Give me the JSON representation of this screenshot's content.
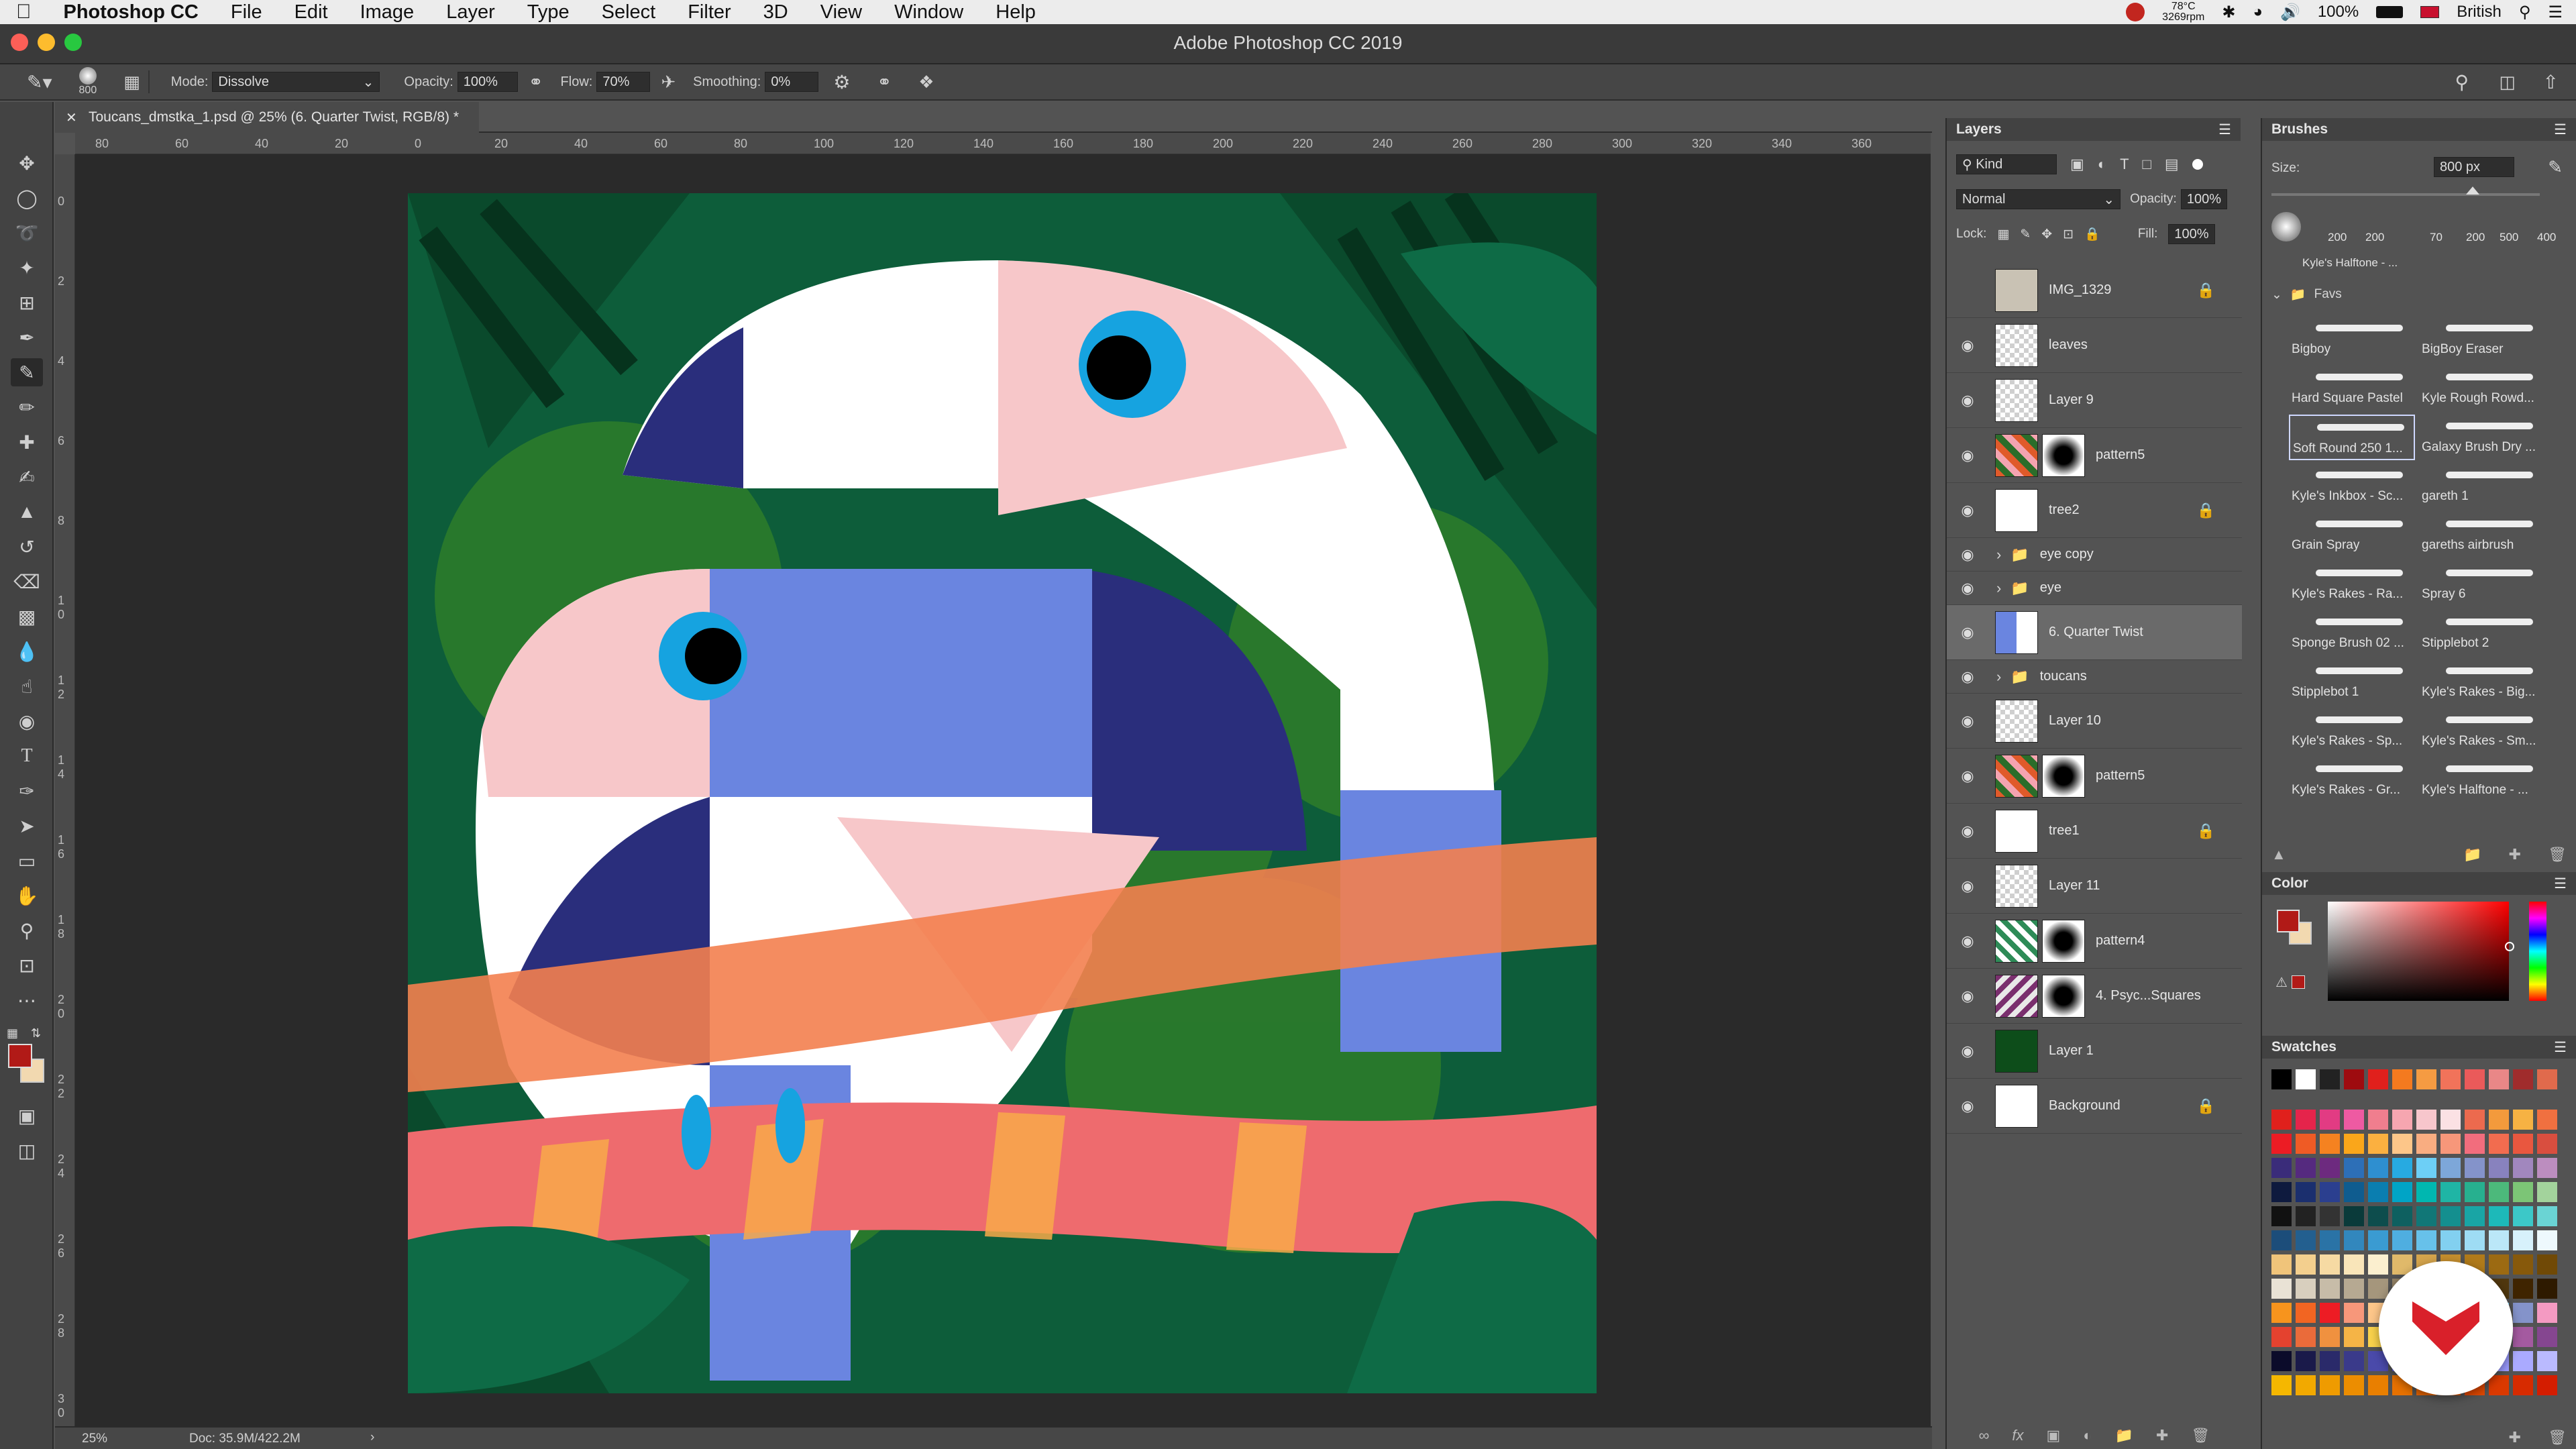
{
  "menubar": {
    "app_name": "Photoshop CC",
    "items": [
      "File",
      "Edit",
      "Image",
      "Layer",
      "Type",
      "Select",
      "Filter",
      "3D",
      "View",
      "Window",
      "Help"
    ],
    "cpu_temp": "78°C",
    "fan_rpm": "3269rpm",
    "battery": "100%",
    "keyboard": "British"
  },
  "window": {
    "title": "Adobe Photoshop CC 2019"
  },
  "options": {
    "brush_size": "800",
    "mode_label": "Mode:",
    "mode_value": "Dissolve",
    "opacity_label": "Opacity:",
    "opacity_value": "100%",
    "flow_label": "Flow:",
    "flow_value": "70%",
    "smoothing_label": "Smoothing:",
    "smoothing_value": "0%"
  },
  "document": {
    "tab_title": "Toucans_dmstka_1.psd @ 25% (6. Quarter Twist, RGB/8) *",
    "ruler_h": [
      "80",
      "60",
      "40",
      "20",
      "0",
      "20",
      "40",
      "60",
      "80",
      "100",
      "120",
      "140",
      "160",
      "180",
      "200",
      "220",
      "240",
      "260",
      "280",
      "300",
      "320",
      "340",
      "360"
    ],
    "ruler_v": [
      "0",
      "2",
      "4",
      "6",
      "8",
      "1 0",
      "1 2",
      "1 4",
      "1 6",
      "1 8",
      "2 0",
      "2 2",
      "2 4",
      "2 6",
      "2 8",
      "3 0"
    ],
    "zoom": "25%",
    "doc_size": "Doc: 35.9M/422.2M"
  },
  "layers_panel": {
    "title": "Layers",
    "filter_kind": "Kind",
    "blend_mode": "Normal",
    "opacity_label": "Opacity:",
    "opacity": "100%",
    "lock_label": "Lock:",
    "fill_label": "Fill:",
    "fill": "100%",
    "layers": [
      {
        "name": "IMG_1329",
        "visible": false,
        "locked": true
      },
      {
        "name": "leaves",
        "visible": true
      },
      {
        "name": "Layer 9",
        "visible": true
      },
      {
        "name": "pattern5",
        "visible": true,
        "mask": true
      },
      {
        "name": "tree2",
        "visible": true,
        "locked": true
      },
      {
        "name": "eye copy",
        "visible": true,
        "group": true
      },
      {
        "name": "eye",
        "visible": true,
        "group": true
      },
      {
        "name": "6. Quarter Twist",
        "visible": true,
        "selected": true
      },
      {
        "name": "toucans",
        "visible": true,
        "group": true
      },
      {
        "name": "Layer 10",
        "visible": true
      },
      {
        "name": "pattern5",
        "visible": true,
        "mask": true
      },
      {
        "name": "tree1",
        "visible": true,
        "locked": true
      },
      {
        "name": "Layer 11",
        "visible": true
      },
      {
        "name": "pattern4",
        "visible": true,
        "mask": true
      },
      {
        "name": "4. Psyc...Squares",
        "visible": true,
        "mask": true
      },
      {
        "name": "Layer 1",
        "visible": true
      },
      {
        "name": "Background",
        "visible": true,
        "locked": true
      }
    ]
  },
  "brushes_panel": {
    "title": "Brushes",
    "size_label": "Size:",
    "size_value": "800 px",
    "preset_sizes": [
      "200",
      "200",
      "70",
      "200",
      "500",
      "400"
    ],
    "current_label": "Kyle's Halftone - ...",
    "group_name": "Favs",
    "brushes": [
      "Bigboy",
      "BigBoy Eraser",
      "Hard Square Pastel",
      "Kyle Rough Rowd...",
      "Soft Round 250 1...",
      "Galaxy Brush Dry ...",
      "Kyle's Inkbox - Sc...",
      "gareth 1",
      "Grain Spray",
      "gareths airbrush",
      "Kyle's Rakes - Ra...",
      "Spray 6",
      "Sponge Brush 02 ...",
      "Stipplebot 2",
      "Stipplebot 1",
      "Kyle's Rakes - Big...",
      "Kyle's Rakes - Sp...",
      "Kyle's Rakes - Sm...",
      "Kyle's Rakes - Gr...",
      "Kyle's Halftone - ..."
    ]
  },
  "color_panel": {
    "title": "Color",
    "foreground": "#b11a17",
    "background": "#f2d9b0"
  },
  "swatches_panel": {
    "title": "Swatches"
  }
}
